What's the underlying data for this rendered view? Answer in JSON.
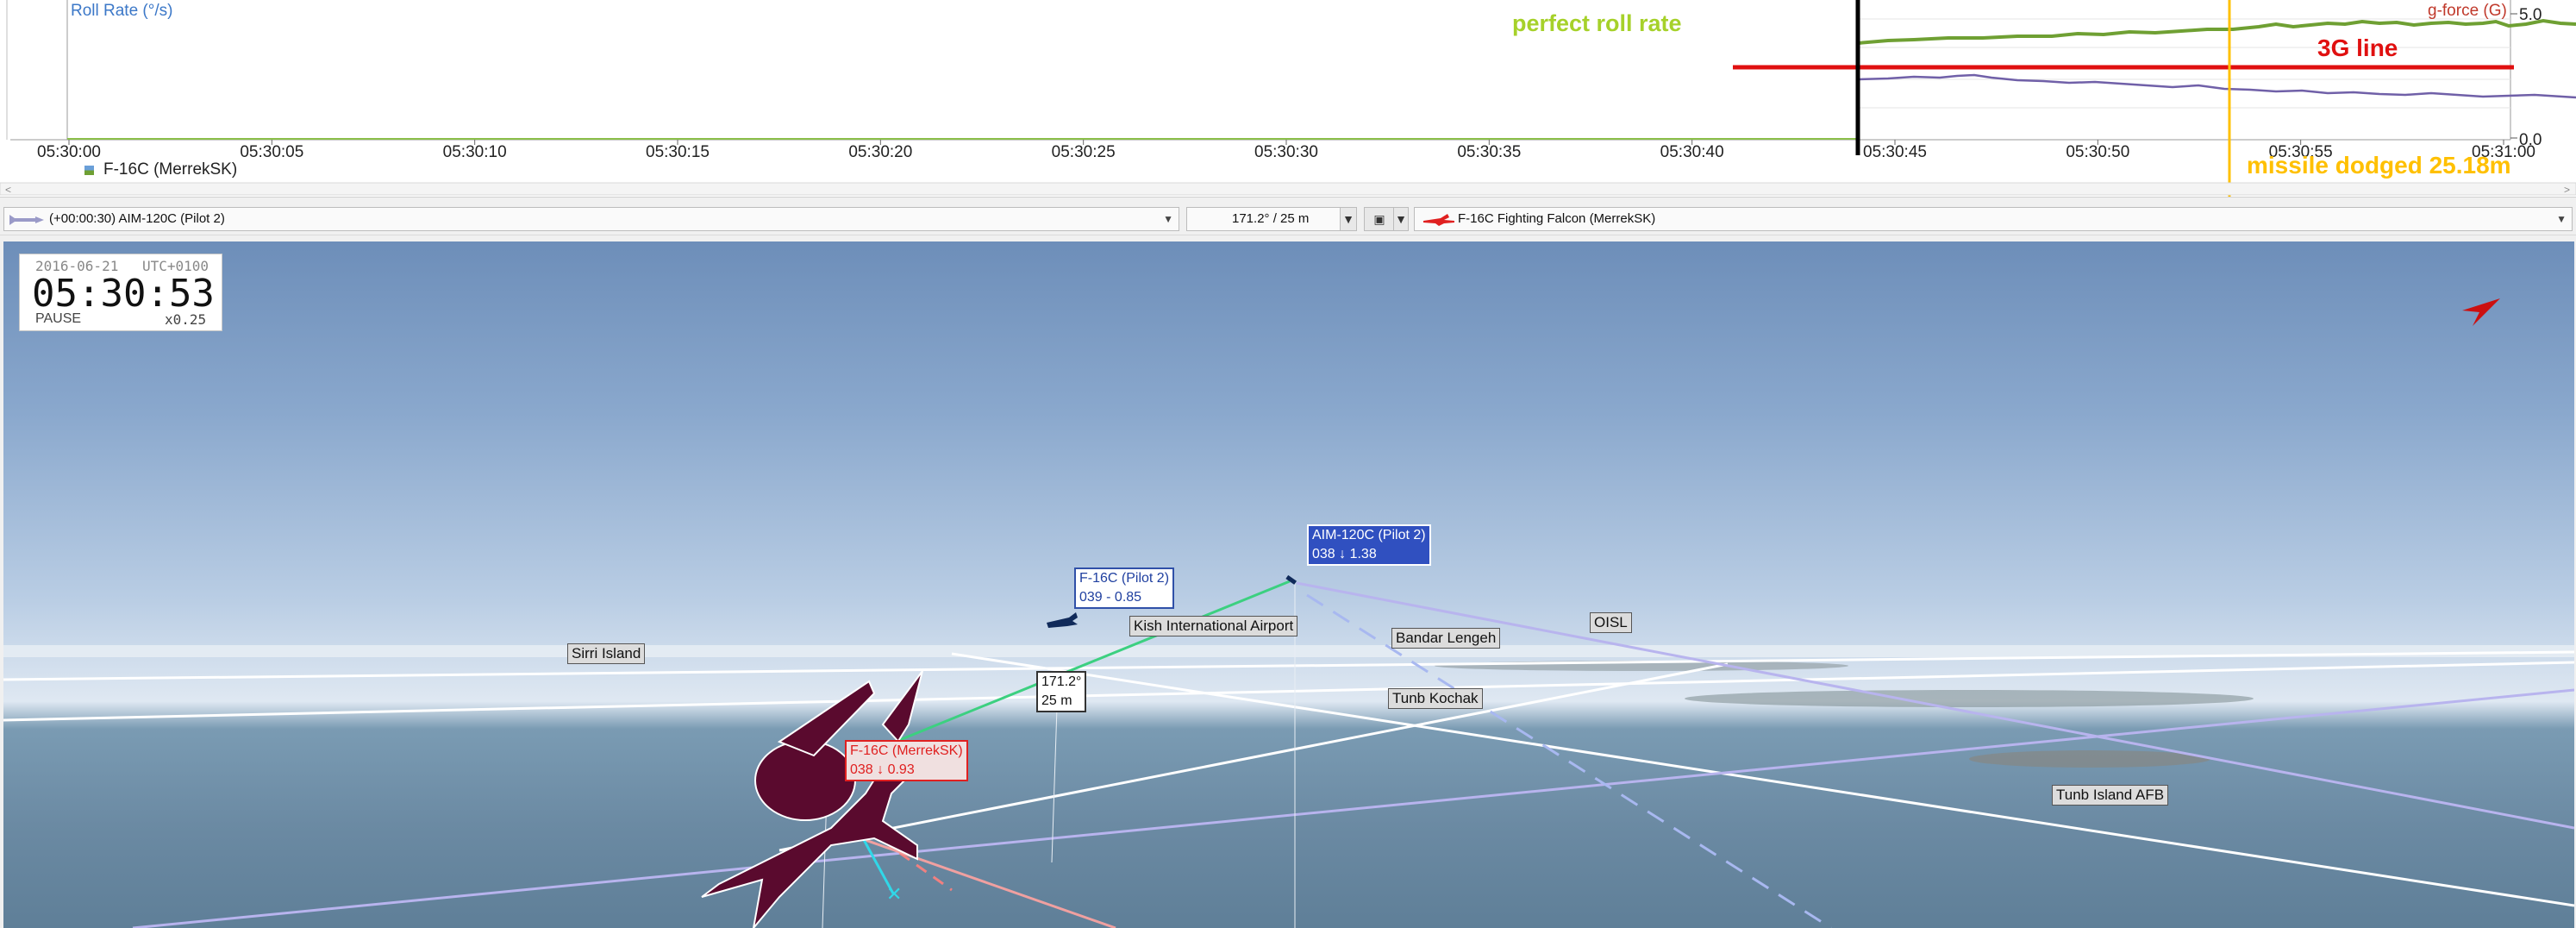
{
  "chart": {
    "left_title": "Roll Rate (°/s)",
    "right_title": "g-force (G)",
    "right_ticks": [
      "5.0",
      "0.0"
    ],
    "x_ticks": [
      "05:30:00",
      "05:30:05",
      "05:30:10",
      "05:30:15",
      "05:30:20",
      "05:30:25",
      "05:30:30",
      "05:30:35",
      "05:30:40",
      "05:30:45",
      "05:30:50",
      "05:30:55",
      "05:31:00"
    ],
    "legend_label": "F-16C (MerrekSK)",
    "colors": {
      "green": "#6fa033",
      "purple": "#7060a8",
      "red": "#e01010",
      "gold": "#ffc000",
      "lime": "#a6d12a"
    }
  },
  "annotations": {
    "perfect_roll": "perfect roll rate",
    "three_g": "3G line",
    "missile_dodged": "missile dodged 25.18m"
  },
  "toolbar": {
    "left_selector": "(+00:00:30) AIM-120C (Pilot 2)",
    "distance_selector": "171.2° / 25 m",
    "aircraft_selector": "F-16C Fighting Falcon (MerrekSK)"
  },
  "clock": {
    "date": "2016-06-21",
    "tz": "UTC+0100",
    "time": "05:30:53",
    "state": "PAUSE",
    "speed": "x0.25"
  },
  "map_labels": {
    "sirri": "Sirri Island",
    "kish": "Kish International Airport",
    "bandar": "Bandar Lengeh",
    "oisl": "OISL",
    "tunb_kochak": "Tunb Kochak",
    "tunb_afb": "Tunb Island AFB"
  },
  "objects": {
    "pilot2": {
      "name": "F-16C (Pilot 2)",
      "info": "039 - 0.85"
    },
    "missile": {
      "name": "AIM-120C (Pilot 2)",
      "info": "038 ↓ 1.38"
    },
    "player": {
      "name": "F-16C (MerrekSK)",
      "info": "038 ↓ 0.93"
    },
    "bearing": {
      "angle": "171.2°",
      "dist": "25 m"
    }
  },
  "icons": [
    "aircraft-icon",
    "missile-icon",
    "compass-arrow-icon",
    "camera-icon",
    "chevron-down-icon"
  ]
}
